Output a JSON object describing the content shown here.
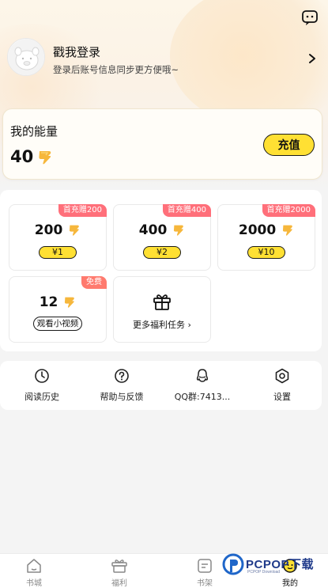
{
  "header": {
    "chat_icon": "chat-bubble-icon",
    "login_title": "戳我登录",
    "login_subtitle": "登录后账号信息同步更方便哦~",
    "arrow_icon": "chevron-right-icon"
  },
  "energy": {
    "label": "我的能量",
    "value": "40",
    "icon": "energy-bolt-icon",
    "recharge_label": "充值"
  },
  "packs": [
    {
      "badge": "首充赠200",
      "amount": "200",
      "price": "¥1"
    },
    {
      "badge": "首充赠400",
      "amount": "400",
      "price": "¥2"
    },
    {
      "badge": "首充赠2000",
      "amount": "2000",
      "price": "¥10"
    }
  ],
  "video_pack": {
    "badge": "免费",
    "amount": "12",
    "action": "观看小视频"
  },
  "more_tasks": {
    "label": "更多福利任务",
    "icon": "gift-icon"
  },
  "menu": [
    {
      "label": "阅读历史",
      "icon": "history-clock-icon"
    },
    {
      "label": "帮助与反馈",
      "icon": "help-question-icon"
    },
    {
      "label": "QQ群:7413...",
      "icon": "qq-penguin-icon"
    },
    {
      "label": "设置",
      "icon": "settings-hexagon-icon"
    }
  ],
  "tabs": [
    {
      "label": "书城",
      "icon": "home-icon",
      "active": false
    },
    {
      "label": "福利",
      "icon": "gift-icon",
      "active": false
    },
    {
      "label": "书架",
      "icon": "bookshelf-icon",
      "active": false
    },
    {
      "label": "我的",
      "icon": "profile-icon",
      "active": true
    }
  ],
  "watermark": {
    "text": "PCPOP下载",
    "sub": "PCPOP Download"
  },
  "colors": {
    "accent_yellow": "#ffe033",
    "badge_red": "#ff6f7a",
    "bolt_orange": "#f6b73c"
  }
}
